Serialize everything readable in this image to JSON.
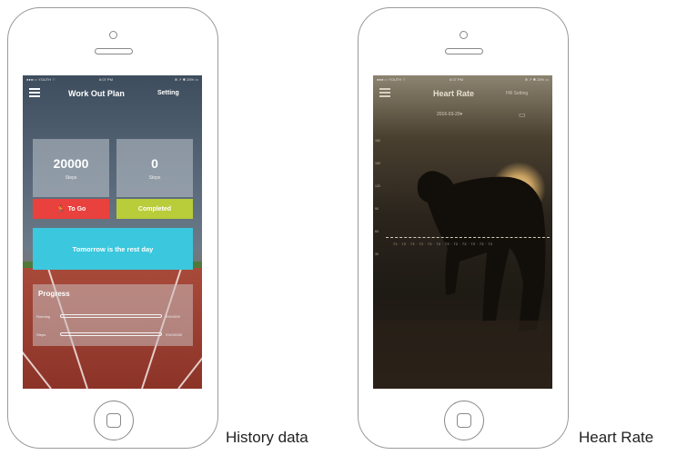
{
  "captions": {
    "left": "History data",
    "right": "Heart Rate"
  },
  "workout_screen": {
    "status_bar": {
      "carrier": "●●●○○ YOUTH ⌔",
      "time": "6:07 PM",
      "right": "⊕ ↗ ✱ 25% ▭"
    },
    "menu_icon": "hamburger-menu-icon",
    "title": "Work Out Plan",
    "setting_label": "Setting",
    "cards": [
      {
        "value": "20000",
        "unit": "Steps"
      },
      {
        "value": "0",
        "unit": "Steps"
      }
    ],
    "to_go_label": "To Go",
    "to_go_icon": "🏃",
    "completed_label": "Completed",
    "rest_banner": "Tomorrow is the rest day",
    "progress": {
      "title": "Progress",
      "rows": [
        {
          "label": "Running",
          "end": "0%/1000",
          "fraction": 0
        },
        {
          "label": "Steps",
          "end": "0%/10000",
          "fraction": 0
        }
      ]
    },
    "colors": {
      "to_go": "#e8413e",
      "completed": "#b9cc3a",
      "rest": "#3bc7dd"
    }
  },
  "heart_rate_screen": {
    "status_bar": {
      "carrier": "●●●○○ YOUTH ⌔",
      "time": "6:07 PM",
      "right": "⊕ ↗ ✱ 25% ▭"
    },
    "menu_icon": "hamburger-menu-icon",
    "title": "Heart Rate",
    "setting_label": "HR Setting",
    "date": "2016-03-20▾",
    "calendar_icon": "calendar-icon",
    "y_ticks": [
      "180",
      "150",
      "120",
      "90",
      "60",
      "30"
    ],
    "dash_values": "72 · 72 · 72 · 72 · 72 · 72 · 72 · 72 · 72 · 72 · 72 · 72"
  }
}
